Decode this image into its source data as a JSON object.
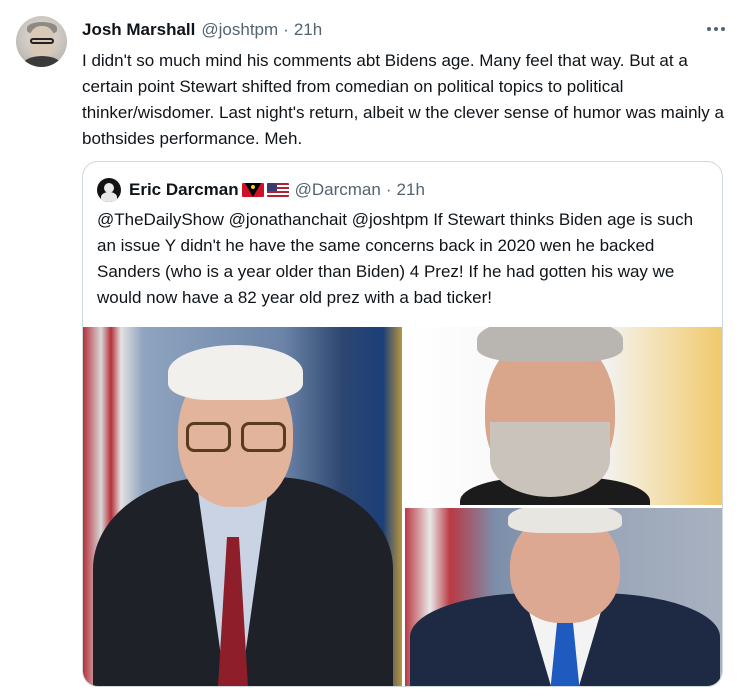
{
  "tweet": {
    "author_name": "Josh Marshall",
    "author_handle": "@joshtpm",
    "separator": "·",
    "time": "21h",
    "text": "I didn't so much mind his comments abt Bidens age. Many feel that way. But at a certain point Stewart shifted from comedian on political topics to political thinker/wisdomer. Last night's return, albeit w the clever sense of humor was mainly a bothsides performance. Meh.",
    "more_icon": "more-horizontal-icon"
  },
  "quote": {
    "author_name": "Eric Darcman",
    "flags": [
      "antigua-and-barbuda-flag",
      "us-flag"
    ],
    "author_handle": "@Darcman",
    "separator": "·",
    "time": "21h",
    "text": "@TheDailyShow @jonathanchait @joshtpm If Stewart thinks Biden age is such an issue Y didn't he have the same concerns back in 2020 wen he backed Sanders (who is a year older than Biden) 4 Prez! If he had gotten his way we would now have a 82 year old prez with a bad ticker!",
    "media_count": 3
  },
  "colors": {
    "text": "#0f1419",
    "secondary": "#536471",
    "border": "#cfd9de",
    "background": "#ffffff"
  }
}
